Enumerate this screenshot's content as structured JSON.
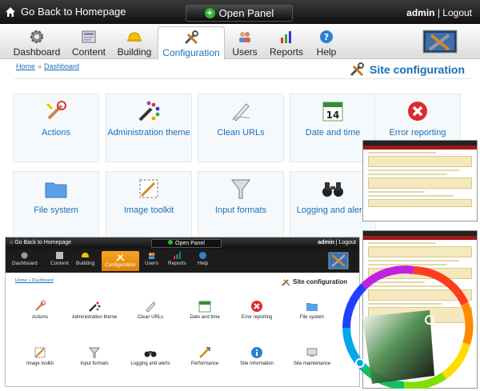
{
  "topbar": {
    "home_label": "Go Back to Homepage",
    "open_panel": "Open Panel",
    "user": "admin",
    "separator": "|",
    "logout": "Logout"
  },
  "nav": [
    {
      "label": "Dashboard",
      "icon": "gear-icon"
    },
    {
      "label": "Content",
      "icon": "content-icon"
    },
    {
      "label": "Building",
      "icon": "hardhat-icon"
    },
    {
      "label": "Configuration",
      "icon": "tools-icon",
      "active": true
    },
    {
      "label": "Users",
      "icon": "users-icon"
    },
    {
      "label": "Reports",
      "icon": "bar-chart-icon"
    },
    {
      "label": "Help",
      "icon": "help-icon"
    }
  ],
  "breadcrumb": {
    "home": "Home",
    "sep": "»",
    "current": "Dashboard"
  },
  "page_title": "Site configuration",
  "tiles": [
    {
      "label": "Actions",
      "icon": "actions-icon"
    },
    {
      "label": "Administration theme",
      "icon": "palette-icon"
    },
    {
      "label": "Clean URLs",
      "icon": "pen-icon"
    },
    {
      "label": "Date and time",
      "icon": "calendar-icon",
      "day": "14"
    },
    {
      "label": "Error reporting",
      "icon": "error-icon"
    },
    {
      "label": "File system",
      "icon": "folder-icon"
    },
    {
      "label": "Image toolkit",
      "icon": "image-toolkit-icon"
    },
    {
      "label": "Input formats",
      "icon": "funnel-icon"
    },
    {
      "label": "Logging and alerts",
      "icon": "binoculars-icon"
    }
  ],
  "small": {
    "home_label": "Go Back to Homepage",
    "open_panel": "Open Panel",
    "user": "admin",
    "logout": "Logout",
    "nav": [
      "Dashboard",
      "Content",
      "Building",
      "Configuration",
      "Users",
      "Reports",
      "Help"
    ],
    "breadcrumb": "Home » Dashboard",
    "page_title": "Site configuration",
    "row1": [
      "Actions",
      "Administration theme",
      "Clean URLs",
      "Date and time",
      "Error reporting",
      "File system"
    ],
    "row2": [
      "Image toolkit",
      "Input formats",
      "Logging and alerts",
      "Performance",
      "Site information",
      "Site maintenance"
    ]
  },
  "colors": {
    "accent": "#1a6fb5",
    "active_tab_small": "#f39a1a",
    "topbar": "#1a1a1a"
  }
}
